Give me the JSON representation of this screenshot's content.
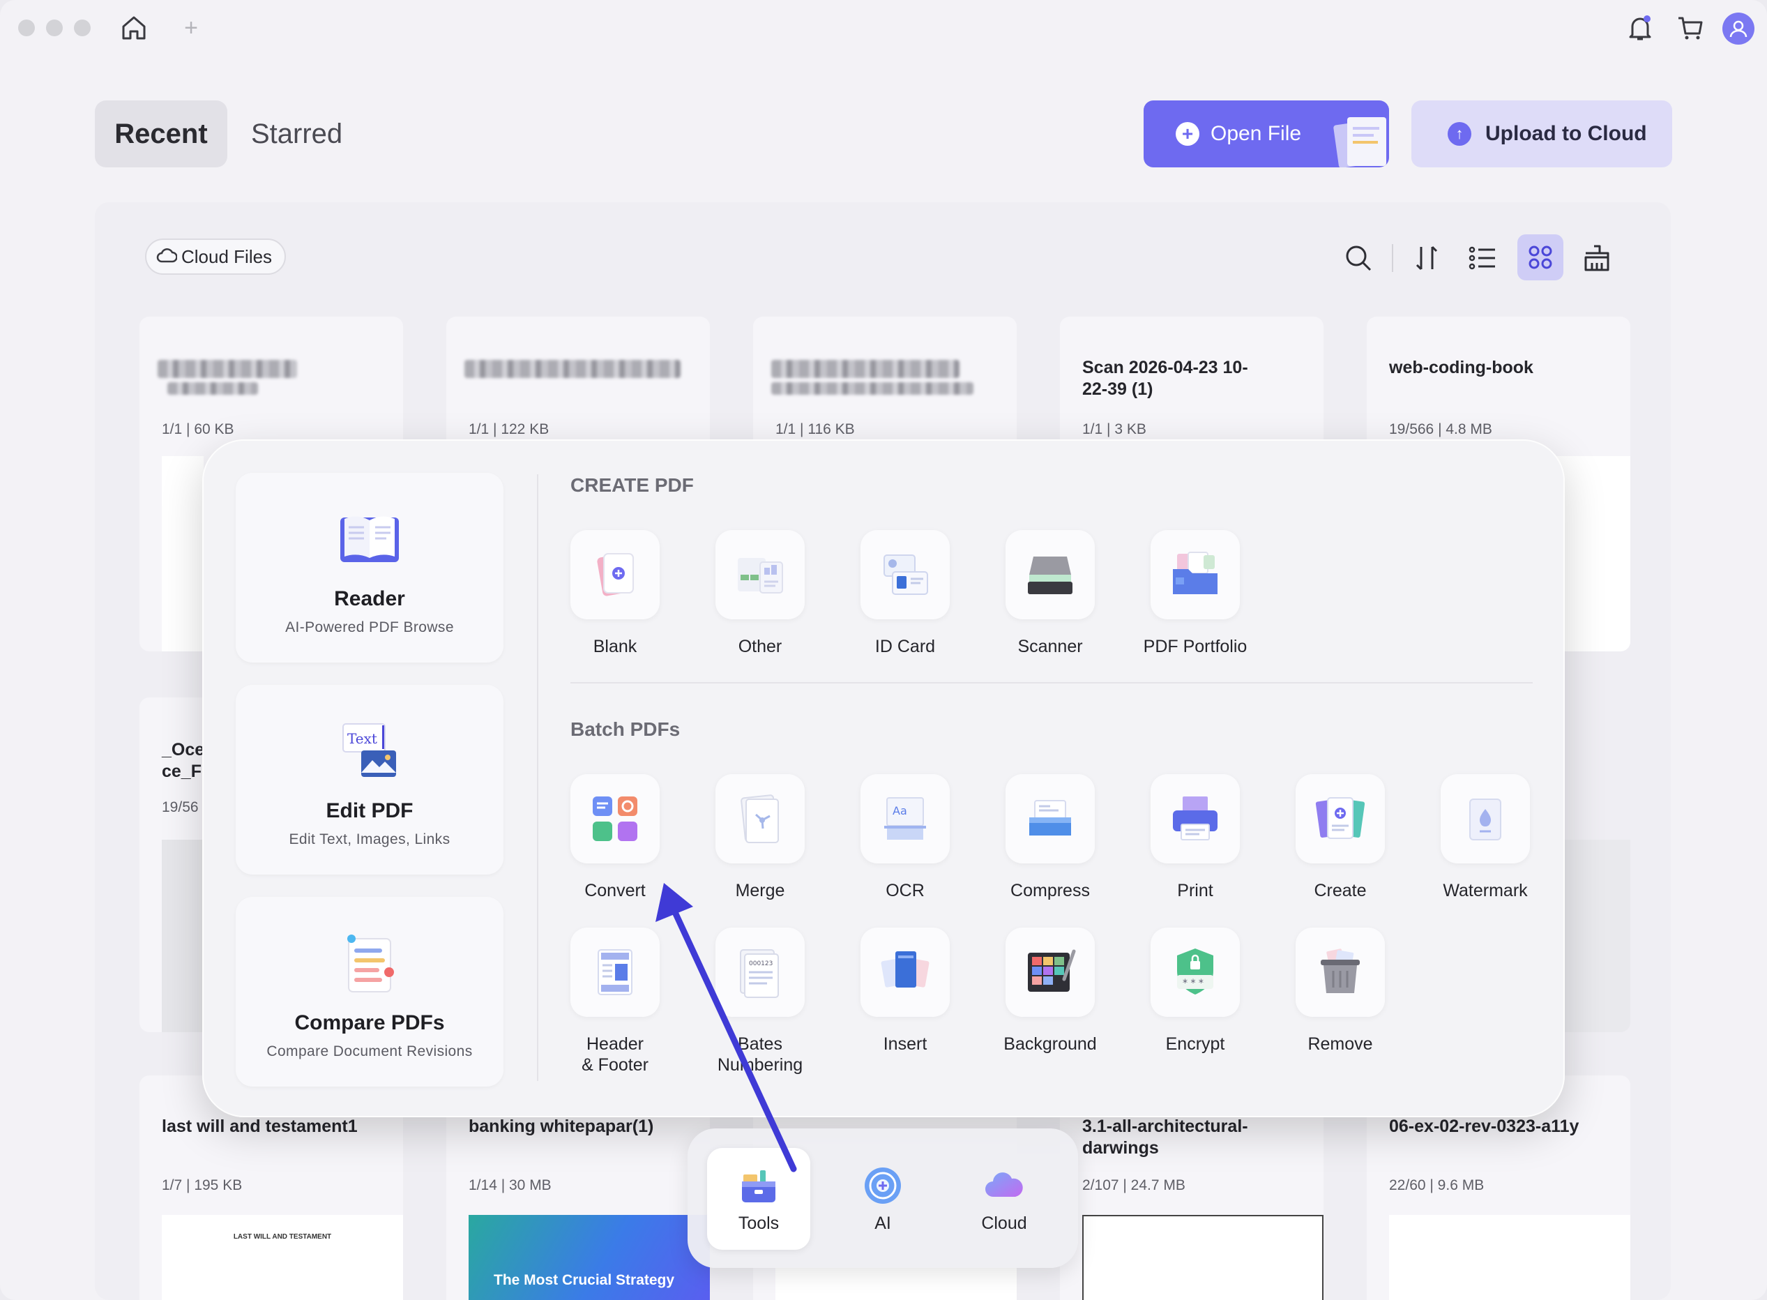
{
  "tabs": {
    "recent": "Recent",
    "starred": "Starred"
  },
  "buttons": {
    "open_file": "Open File",
    "upload_cloud": "Upload to Cloud"
  },
  "filter": {
    "cloud_files": "Cloud Files"
  },
  "files_top": [
    {
      "title": "",
      "meta": "1/1  |  60 KB"
    },
    {
      "title": "",
      "meta": "1/1  |  122 KB"
    },
    {
      "title": "",
      "meta": "1/1  |  116 KB"
    },
    {
      "title": "Scan 2026-04-23 10-22-39 (1)",
      "meta": "1/1  |  3 KB"
    },
    {
      "title": "web-coding-book",
      "meta": "19/566  |  4.8 MB"
    }
  ],
  "files_middle": [
    {
      "title": "_Oce ce_F",
      "meta": "19/56"
    }
  ],
  "files_bottom": [
    {
      "title": "last will and testament1",
      "meta": "1/7  |  195 KB",
      "thumb_text": "LAST WILL AND TESTAMENT"
    },
    {
      "title": "banking whitepapar(1)",
      "meta": "1/14  |  30 MB",
      "thumb_text": "The Most Crucial Strategy"
    },
    {
      "title": "",
      "meta": ""
    },
    {
      "title": "3.1-all-architectural-darwings",
      "meta": "2/107  |  24.7 MB"
    },
    {
      "title": "06-ex-02-rev-0323-a11y",
      "meta": "22/60  |  9.6 MB"
    }
  ],
  "popup": {
    "features": [
      {
        "title": "Reader",
        "subtitle": "AI-Powered PDF Browse"
      },
      {
        "title": "Edit PDF",
        "subtitle": "Edit Text, Images, Links"
      },
      {
        "title": "Compare PDFs",
        "subtitle": "Compare Document Revisions"
      }
    ],
    "create_title": "CREATE PDF",
    "create_items": [
      "Blank",
      "Other",
      "ID Card",
      "Scanner",
      "PDF Portfolio"
    ],
    "batch_title": "Batch PDFs",
    "batch_row1": [
      "Convert",
      "Merge",
      "OCR",
      "Compress",
      "Print",
      "Create",
      "Watermark"
    ],
    "batch_row2": [
      "Header\n& Footer",
      "Bates\nNumbering",
      "Insert",
      "Background",
      "Encrypt",
      "Remove"
    ]
  },
  "dock": {
    "tools": "Tools",
    "ai": "AI",
    "cloud": "Cloud"
  },
  "icons": {
    "home": "home-icon",
    "new_tab": "plus-icon",
    "bell": "bell-icon",
    "cart": "cart-icon",
    "avatar": "user-icon",
    "search": "search-icon",
    "sort": "sort-icon",
    "list": "list-view-icon",
    "grid": "grid-view-icon",
    "clean": "clean-icon"
  },
  "colors": {
    "accent": "#6e6af0",
    "upload_bg": "#dedcf8",
    "arrow": "#3f3ad6"
  }
}
